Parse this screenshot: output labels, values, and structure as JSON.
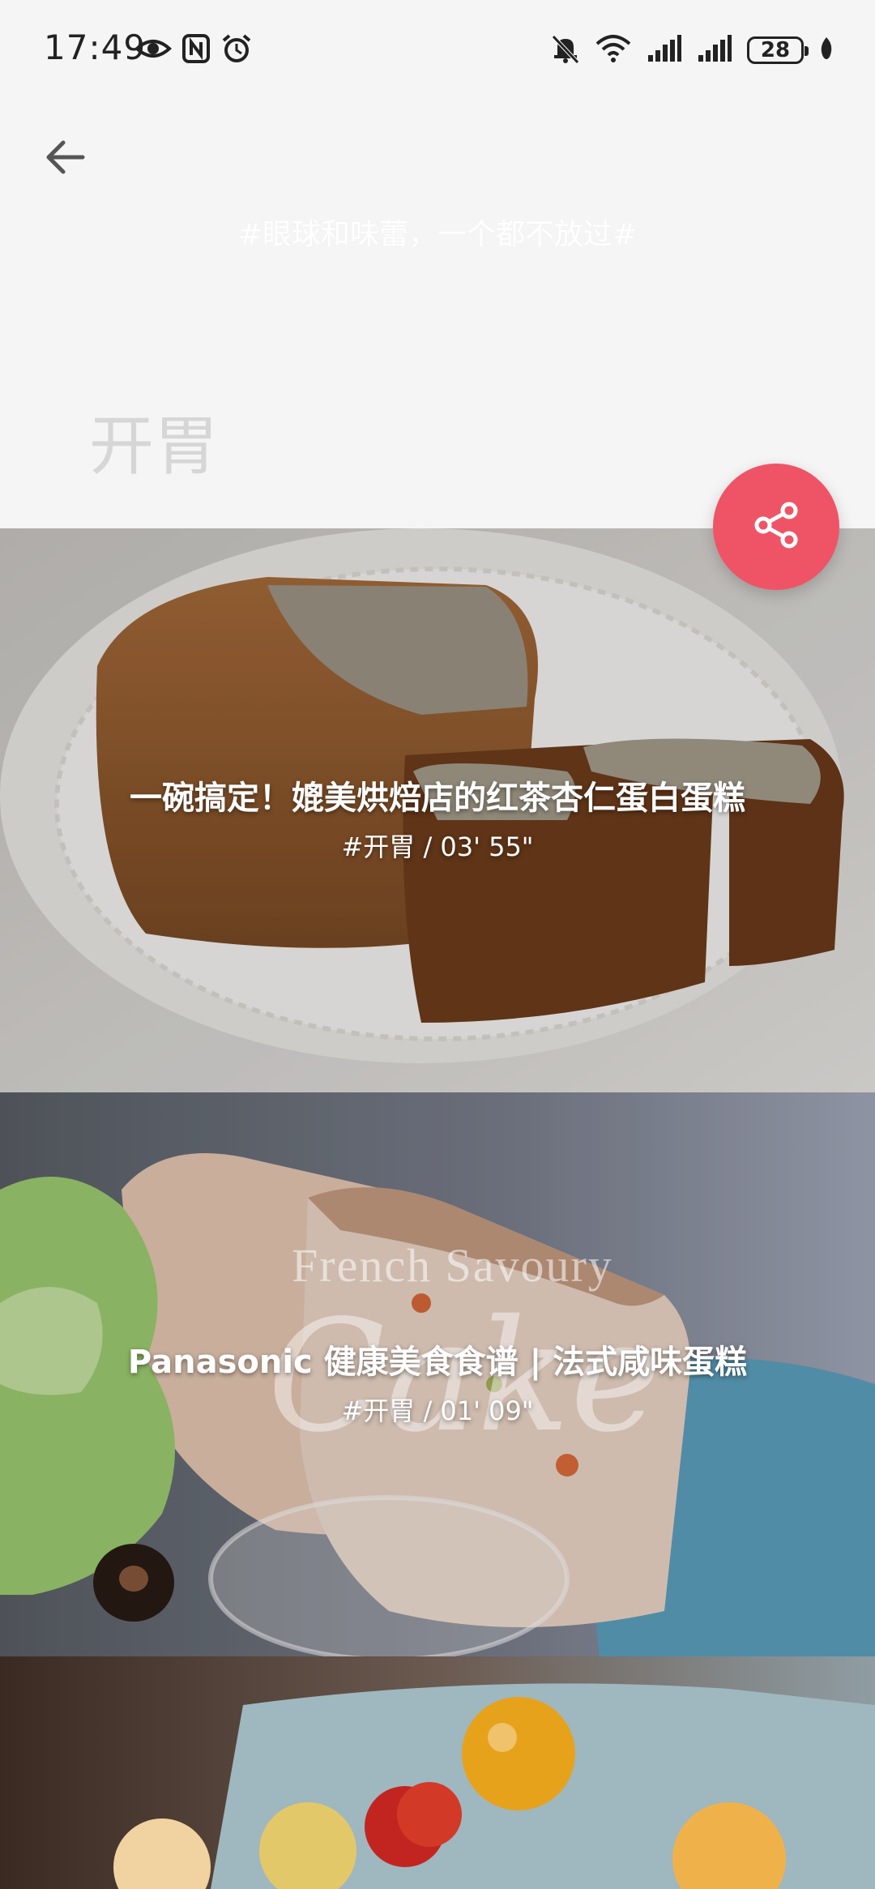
{
  "status_bar": {
    "time": "17:49",
    "battery": "28",
    "left_icons": [
      "eye-icon",
      "nfc-icon",
      "alarm-icon"
    ],
    "right_icons": [
      "bell-off-icon",
      "wifi-icon",
      "signal-icon",
      "signal-icon"
    ]
  },
  "header": {
    "slogan": "#眼球和味蕾，一个都不放过#",
    "category_title": "开胃"
  },
  "colors": {
    "accent": "#ef5466",
    "background": "#f5f5f5"
  },
  "videos": [
    {
      "title": "一碗搞定！媲美烘焙店的红茶杏仁蛋白蛋糕",
      "meta": "#开胃 / 03' 55\""
    },
    {
      "title": "Panasonic 健康美食食谱 | 法式咸味蛋糕",
      "meta": "#开胃 / 01' 09\"",
      "watermark_line1": "French Savoury",
      "watermark_line2": "Cake"
    }
  ]
}
